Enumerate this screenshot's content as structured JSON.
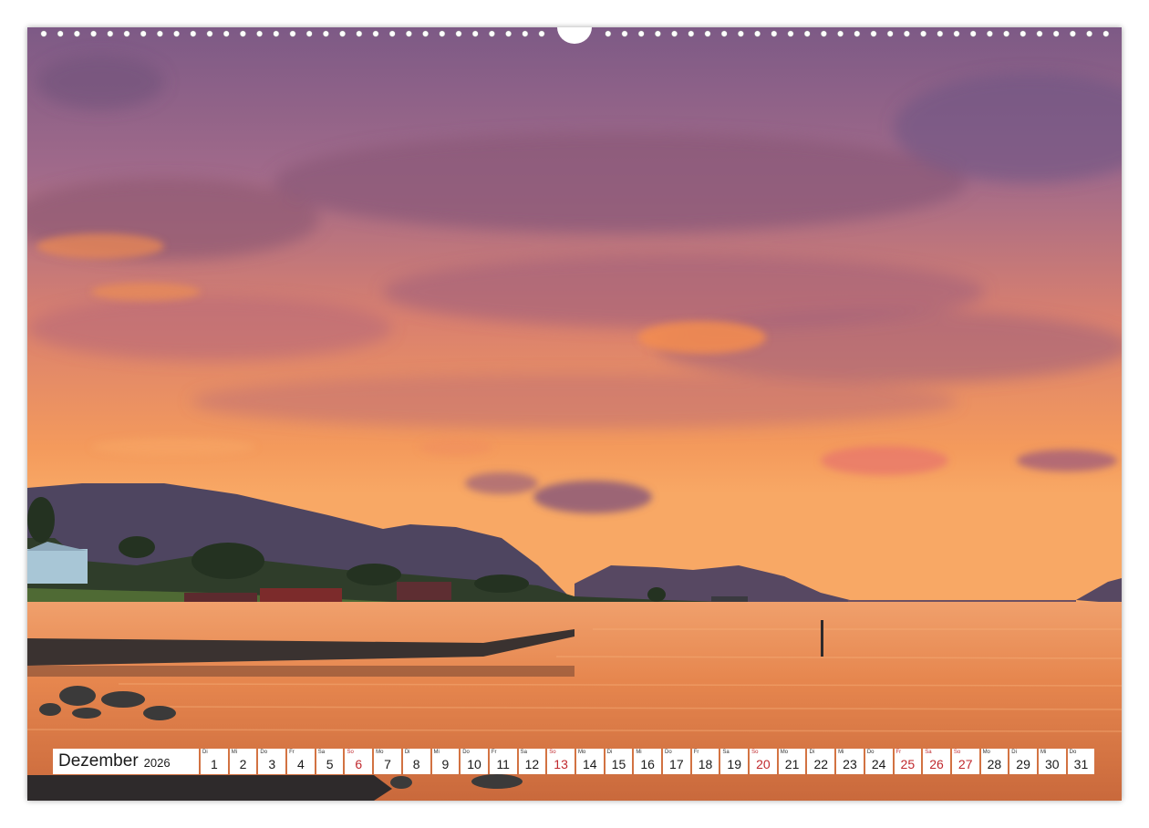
{
  "calendar": {
    "month": "Dezember",
    "year": "2026",
    "days": [
      {
        "wd": "Di",
        "num": "1",
        "weekend": false
      },
      {
        "wd": "Mi",
        "num": "2",
        "weekend": false
      },
      {
        "wd": "Do",
        "num": "3",
        "weekend": false
      },
      {
        "wd": "Fr",
        "num": "4",
        "weekend": false
      },
      {
        "wd": "Sa",
        "num": "5",
        "weekend": false
      },
      {
        "wd": "So",
        "num": "6",
        "weekend": true
      },
      {
        "wd": "Mo",
        "num": "7",
        "weekend": false
      },
      {
        "wd": "Di",
        "num": "8",
        "weekend": false
      },
      {
        "wd": "Mi",
        "num": "9",
        "weekend": false
      },
      {
        "wd": "Do",
        "num": "10",
        "weekend": false
      },
      {
        "wd": "Fr",
        "num": "11",
        "weekend": false
      },
      {
        "wd": "Sa",
        "num": "12",
        "weekend": false
      },
      {
        "wd": "So",
        "num": "13",
        "weekend": true
      },
      {
        "wd": "Mo",
        "num": "14",
        "weekend": false
      },
      {
        "wd": "Di",
        "num": "15",
        "weekend": false
      },
      {
        "wd": "Mi",
        "num": "16",
        "weekend": false
      },
      {
        "wd": "Do",
        "num": "17",
        "weekend": false
      },
      {
        "wd": "Fr",
        "num": "18",
        "weekend": false
      },
      {
        "wd": "Sa",
        "num": "19",
        "weekend": false
      },
      {
        "wd": "So",
        "num": "20",
        "weekend": true
      },
      {
        "wd": "Mo",
        "num": "21",
        "weekend": false
      },
      {
        "wd": "Di",
        "num": "22",
        "weekend": false
      },
      {
        "wd": "Mi",
        "num": "23",
        "weekend": false
      },
      {
        "wd": "Do",
        "num": "24",
        "weekend": false
      },
      {
        "wd": "Fr",
        "num": "25",
        "weekend": true
      },
      {
        "wd": "Sa",
        "num": "26",
        "weekend": true
      },
      {
        "wd": "So",
        "num": "27",
        "weekend": true
      },
      {
        "wd": "Mo",
        "num": "28",
        "weekend": false
      },
      {
        "wd": "Di",
        "num": "29",
        "weekend": false
      },
      {
        "wd": "Mi",
        "num": "30",
        "weekend": false
      },
      {
        "wd": "Do",
        "num": "31",
        "weekend": false
      }
    ]
  },
  "colors": {
    "weekend": "#c0282d",
    "sky_top": "#8a5f86",
    "sky_horizon": "#f7995a",
    "water": "#e98a52"
  }
}
